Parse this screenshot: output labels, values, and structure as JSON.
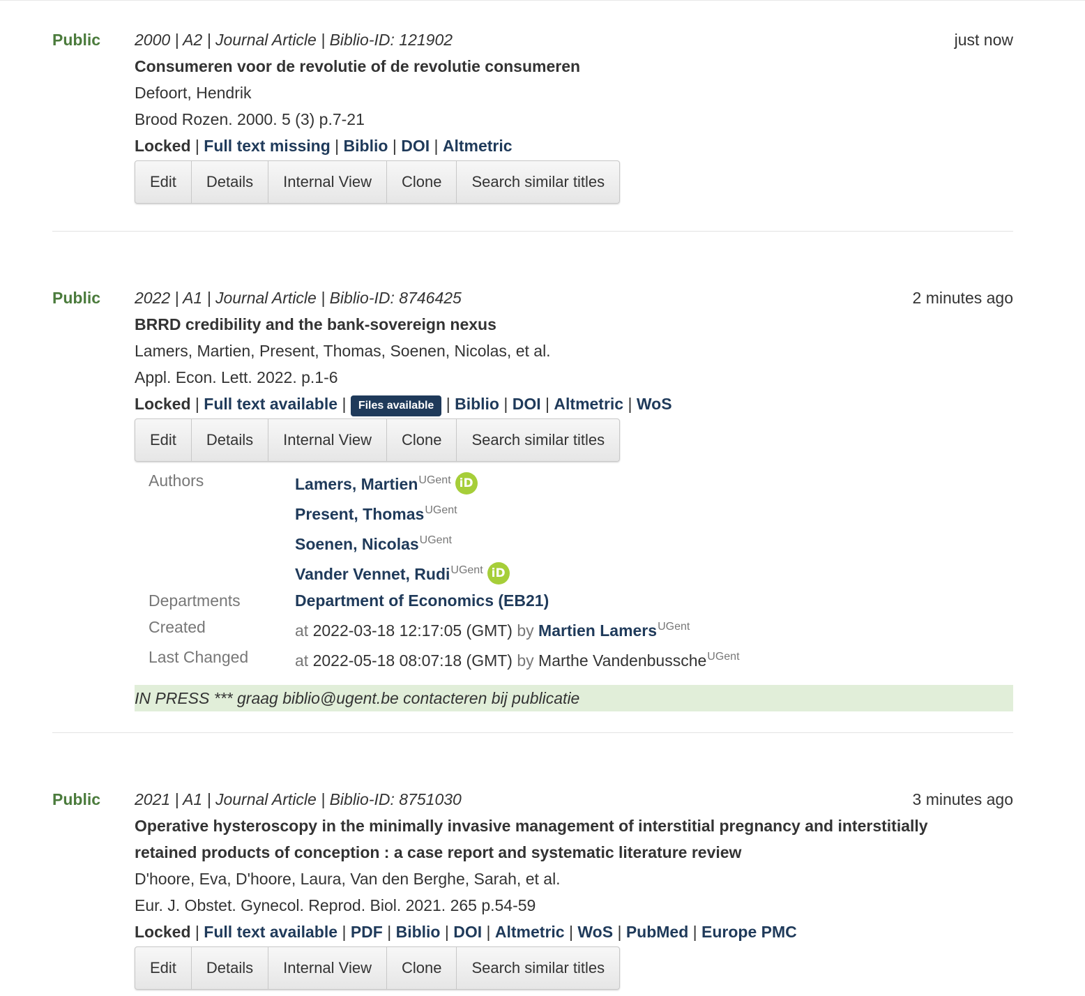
{
  "records": [
    {
      "status": "Public",
      "meta": "2000 | A2 | Journal Article | Biblio-ID: 121902",
      "time": "just now",
      "title": "Consumeren voor de revolutie of de revolutie consumeren",
      "authors": "Defoort, Hendrik",
      "source": "Brood Rozen. 2000. 5 (3) p.7-21",
      "locked": "Locked",
      "fulltext": "Full text missing",
      "links": [
        "Biblio",
        "DOI",
        "Altmetric"
      ],
      "buttons": [
        "Edit",
        "Details",
        "Internal View",
        "Clone",
        "Search similar titles"
      ]
    },
    {
      "status": "Public",
      "meta": "2022 | A1 | Journal Article | Biblio-ID: 8746425",
      "time": "2 minutes ago",
      "title": "BRRD credibility and the bank-sovereign nexus",
      "authors": "Lamers, Martien, Present, Thomas, Soenen, Nicolas, et al.",
      "source": "Appl. Econ. Lett. 2022. p.1-6",
      "locked": "Locked",
      "fulltext": "Full text available",
      "badge": "Files available",
      "links": [
        "Biblio",
        "DOI",
        "Altmetric",
        "WoS"
      ],
      "buttons": [
        "Edit",
        "Details",
        "Internal View",
        "Clone",
        "Search similar titles"
      ],
      "details": {
        "authors_label": "Authors",
        "authors": [
          {
            "name": "Lamers, Martien",
            "aff": "UGent",
            "orcid": "iD"
          },
          {
            "name": "Present, Thomas",
            "aff": "UGent"
          },
          {
            "name": "Soenen, Nicolas",
            "aff": "UGent"
          },
          {
            "name": "Vander Vennet, Rudi",
            "aff": "UGent",
            "orcid": "iD"
          }
        ],
        "departments_label": "Departments",
        "department": "Department of Economics (EB21)",
        "created_label": "Created",
        "created_at": "at",
        "created_date": "2022-03-18 12:17:05 (GMT)",
        "created_by": "by",
        "created_user": "Martien Lamers",
        "created_aff": "UGent",
        "changed_label": "Last Changed",
        "changed_at": "at",
        "changed_date": "2022-05-18 08:07:18 (GMT)",
        "changed_by": "by",
        "changed_user": "Marthe Vandenbussche",
        "changed_aff": "UGent"
      },
      "note": "IN PRESS *** graag biblio@ugent.be contacteren bij publicatie"
    },
    {
      "status": "Public",
      "meta": "2021 | A1 | Journal Article | Biblio-ID: 8751030",
      "time": "3 minutes ago",
      "title": "Operative hysteroscopy in the minimally invasive management of interstitial pregnancy and interstitially retained products of conception : a case report and systematic literature review",
      "authors": "D'hoore, Eva, D'hoore, Laura, Van den Berghe, Sarah, et al.",
      "source": "Eur. J. Obstet. Gynecol. Reprod. Biol. 2021. 265 p.54-59",
      "locked": "Locked",
      "fulltext": "Full text available",
      "links": [
        "PDF",
        "Biblio",
        "DOI",
        "Altmetric",
        "WoS",
        "PubMed",
        "Europe PMC"
      ],
      "buttons": [
        "Edit",
        "Details",
        "Internal View",
        "Clone",
        "Search similar titles"
      ]
    }
  ],
  "colors": {
    "public_green": "#4b7b3c",
    "link_navy": "#1f3a5a",
    "missing_red": "#a53f3f",
    "note_bg": "#e1eed9",
    "orcid_green": "#a6ce39"
  },
  "icons": {
    "orcid": "orcid-icon"
  }
}
